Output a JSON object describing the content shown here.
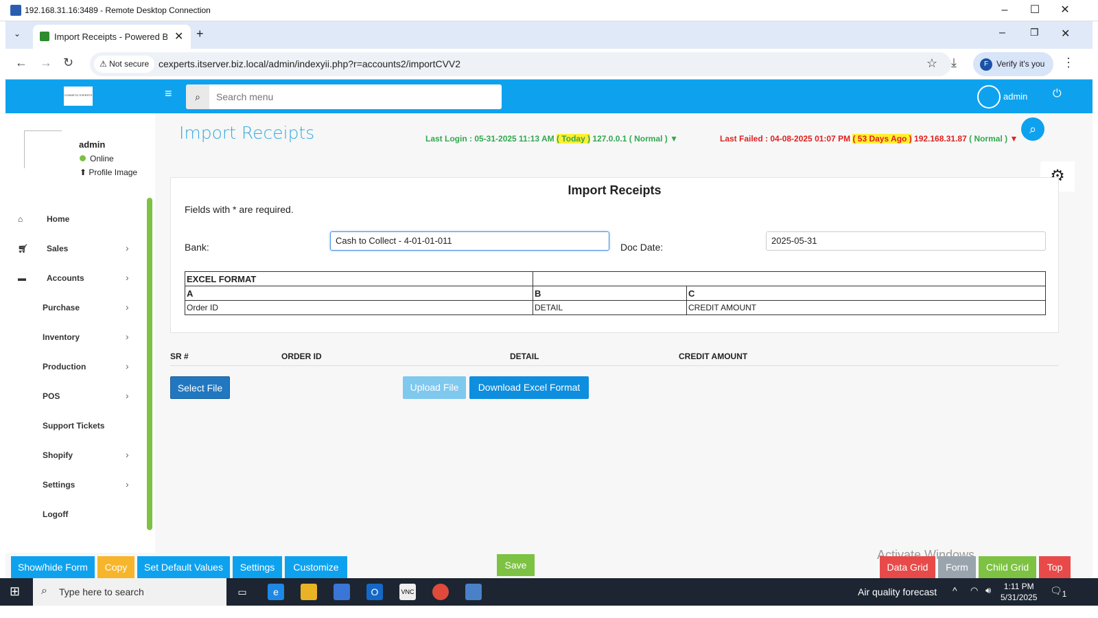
{
  "window": {
    "title": "192.168.31.16:3489 - Remote Desktop Connection",
    "min": "–",
    "max": "☐",
    "close": "✕"
  },
  "browser": {
    "tab_title": "Import Receipts - Powered By C",
    "new_tab": "+",
    "not_secure": "Not secure",
    "url": "cexperts.itserver.biz.local/admin/indexyii.php?r=accounts2/importCVV2",
    "verify": "Verify it's you",
    "verify_initial": "F"
  },
  "header": {
    "logo": "COSMETIC EXPERTS",
    "search_placeholder": "Search menu",
    "user": "admin"
  },
  "sidebar": {
    "user": "admin",
    "status": "Online",
    "profile_image": "Profile Image",
    "items": [
      {
        "label": "Home",
        "has_icon": true,
        "chev": false
      },
      {
        "label": "Sales",
        "has_icon": true,
        "chev": true
      },
      {
        "label": "Accounts",
        "has_icon": true,
        "chev": true
      },
      {
        "label": "Purchase",
        "has_icon": false,
        "chev": true
      },
      {
        "label": "Inventory",
        "has_icon": false,
        "chev": true
      },
      {
        "label": "Production",
        "has_icon": false,
        "chev": true
      },
      {
        "label": "POS",
        "has_icon": false,
        "chev": true
      },
      {
        "label": "Support Tickets",
        "has_icon": false,
        "chev": false
      },
      {
        "label": "Shopify",
        "has_icon": false,
        "chev": true
      },
      {
        "label": "Settings",
        "has_icon": false,
        "chev": true
      },
      {
        "label": "Logoff",
        "has_icon": false,
        "chev": false
      }
    ]
  },
  "page": {
    "title": "Import Receipts",
    "last_login": {
      "prefix": "Last Login : 05-31-2025 11:13 AM ",
      "tag": "( Today )",
      "suffix": " 127.0.0.1 ( Normal ) ▼"
    },
    "last_failed": {
      "prefix": "Last Failed : 04-08-2025 01:07 PM ",
      "tag": "( 53 Days Ago )",
      "suffix_red": " 192.168.31.87 ",
      "suffix_green": "( Normal ) ",
      "arrow": "▼"
    }
  },
  "form": {
    "title": "Import Receipts",
    "required_note": "Fields with * are required.",
    "bank_label": "Bank:",
    "bank_value": "Cash to Collect - 4-01-01-011",
    "doc_date_label": "Doc Date:",
    "doc_date_value": "2025-05-31",
    "excel_table": {
      "header": "EXCEL FORMAT",
      "cols": [
        "A",
        "B",
        "C"
      ],
      "vals": [
        "Order ID",
        "DETAIL",
        "CREDIT AMOUNT"
      ]
    }
  },
  "grid": {
    "columns": [
      "SR #",
      "ORDER ID",
      "DETAIL",
      "CREDIT AMOUNT"
    ]
  },
  "actions": {
    "select_file": "Select File",
    "upload_file": "Upload File",
    "download_format": "Download Excel Format"
  },
  "footer": {
    "show_hide": "Show/hide Form",
    "copy": "Copy",
    "set_defaults": "Set Default Values",
    "settings": "Settings",
    "customize": "Customize",
    "save": "Save",
    "data_grid": "Data Grid",
    "form": "Form",
    "child_grid": "Child Grid",
    "top": "Top",
    "activate": "Activate Windows"
  },
  "taskbar": {
    "search": "Type here to search",
    "aq": "Air quality forecast",
    "time": "1:11 PM",
    "date": "5/31/2025",
    "notif": "1"
  },
  "colors": {
    "accent": "#0ea2ee",
    "green": "#7dc243",
    "title_blue": "#36a8e0",
    "failed_red": "#e02020",
    "login_green": "#31a84f"
  }
}
